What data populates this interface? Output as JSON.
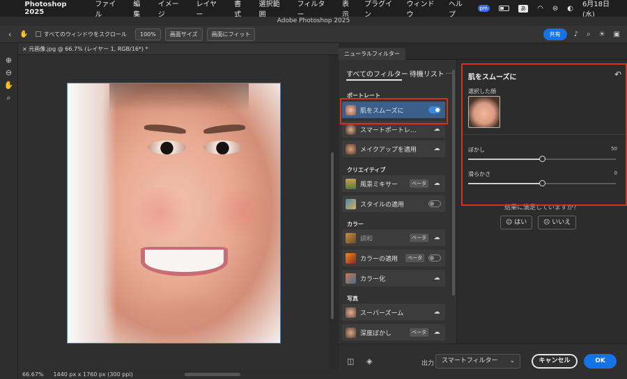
{
  "menubar": {
    "app_name": "Photoshop 2025",
    "items": [
      "ファイル",
      "編集",
      "イメージ",
      "レイヤー",
      "書式",
      "選択範囲",
      "フィルター"
    ],
    "right_items": [
      "表示",
      "プラグイン",
      "ウィンドウ",
      "ヘルプ"
    ],
    "pm_badge": "pm",
    "ime": "あ",
    "date": "6月18日(水)"
  },
  "window": {
    "title": "Adobe Photoshop 2025"
  },
  "options_bar": {
    "scroll_all_label": "すべてのウィンドウをスクロール",
    "zoom_100": "100%",
    "fit_screen": "画面サイズ",
    "fill_screen": "画面にフィット",
    "share": "共有"
  },
  "document": {
    "tab_title": "元画像.jpg @ 66.7% (レイヤー 1, RGB/16*) *",
    "zoom": "66.67%",
    "dimensions": "1440 px x 1760 px (300 ppi)"
  },
  "neural_filters": {
    "panel_tab": "ニューラルフィルター",
    "list_tabs": {
      "all": "すべてのフィルター",
      "waitlist": "待機リスト"
    },
    "sections": {
      "portrait": "ポートレート",
      "creative": "クリエイティブ",
      "color": "カラー",
      "photo": "写真"
    },
    "filters": {
      "skin_smoothing": "肌をスムーズに",
      "smart_portrait": "スマートポートレ…",
      "makeup_transfer": "メイクアップを適用",
      "landscape_mixer": "風景ミキサー",
      "style_transfer": "スタイルの適用",
      "harmonization": "調和",
      "color_transfer": "カラーの適用",
      "colorize": "カラー化",
      "super_zoom": "スーパーズーム",
      "depth_blur": "深度ぼかし"
    },
    "beta_label": "ベータ",
    "settings": {
      "title": "肌をスムーズに",
      "selected_face_label": "選択した顔",
      "blur_label": "ぼかし",
      "blur_value": "50",
      "smoothness_label": "滑らかさ",
      "smoothness_value": "0",
      "blur_fraction": 0.5,
      "smoothness_fraction": 0.5,
      "satisfied_question": "結果に満足していますか？",
      "yes": "はい",
      "no": "いいえ"
    },
    "bottom": {
      "output_label": "出力",
      "output_value": "スマートフィルター",
      "cancel": "キャンセル",
      "ok": "OK"
    }
  },
  "colors": {
    "accent": "#1473e6",
    "highlight": "#d8321e"
  }
}
